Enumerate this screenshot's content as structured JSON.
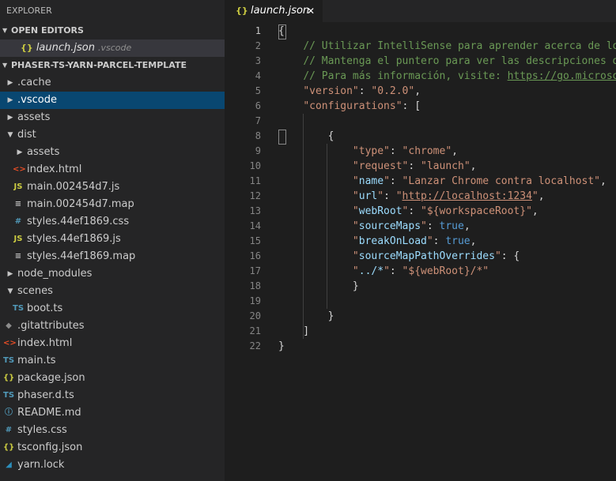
{
  "explorer": {
    "title": "EXPLORER"
  },
  "open_editors": {
    "header": "OPEN EDITORS",
    "items": [
      {
        "icon": "{}",
        "name": "launch.json",
        "dir": ".vscode"
      }
    ]
  },
  "project": {
    "header": "PHASER-TS-YARN-PARCEL-TEMPLATE",
    "tree": [
      {
        "name": ".cache",
        "kind": "folder",
        "expanded": false,
        "depth": 0
      },
      {
        "name": ".vscode",
        "kind": "folder",
        "expanded": false,
        "depth": 0,
        "active": true
      },
      {
        "name": "assets",
        "kind": "folder",
        "expanded": false,
        "depth": 0
      },
      {
        "name": "dist",
        "kind": "folder",
        "expanded": true,
        "depth": 0
      },
      {
        "name": "assets",
        "kind": "folder",
        "expanded": false,
        "depth": 1
      },
      {
        "name": "index.html",
        "kind": "html",
        "icon": "<>",
        "depth": 1
      },
      {
        "name": "main.002454d7.js",
        "kind": "js",
        "icon": "JS",
        "depth": 1
      },
      {
        "name": "main.002454d7.map",
        "kind": "map",
        "icon": "≡",
        "depth": 1
      },
      {
        "name": "styles.44ef1869.css",
        "kind": "css",
        "icon": "#",
        "depth": 1
      },
      {
        "name": "styles.44ef1869.js",
        "kind": "js",
        "icon": "JS",
        "depth": 1
      },
      {
        "name": "styles.44ef1869.map",
        "kind": "map",
        "icon": "≡",
        "depth": 1
      },
      {
        "name": "node_modules",
        "kind": "folder",
        "expanded": false,
        "depth": 0
      },
      {
        "name": "scenes",
        "kind": "folder",
        "expanded": true,
        "depth": 0
      },
      {
        "name": "boot.ts",
        "kind": "ts",
        "icon": "TS",
        "depth": 1
      },
      {
        "name": ".gitattributes",
        "kind": "git",
        "icon": "◆",
        "depth": 0
      },
      {
        "name": "index.html",
        "kind": "html",
        "icon": "<>",
        "depth": 0
      },
      {
        "name": "main.ts",
        "kind": "ts",
        "icon": "TS",
        "depth": 0
      },
      {
        "name": "package.json",
        "kind": "json",
        "icon": "{}",
        "depth": 0
      },
      {
        "name": "phaser.d.ts",
        "kind": "ts",
        "icon": "TS",
        "depth": 0
      },
      {
        "name": "README.md",
        "kind": "info",
        "icon": "ⓘ",
        "depth": 0
      },
      {
        "name": "styles.css",
        "kind": "css",
        "icon": "#",
        "depth": 0
      },
      {
        "name": "tsconfig.json",
        "kind": "json",
        "icon": "{}",
        "depth": 0
      },
      {
        "name": "yarn.lock",
        "kind": "yarn",
        "icon": "◢",
        "depth": 0
      }
    ]
  },
  "tab": {
    "icon": "{}",
    "label": "launch.json",
    "close": "✕"
  },
  "editor": {
    "current_line": 1,
    "lines": [
      [
        [
          "p",
          "{"
        ]
      ],
      [
        [
          "p",
          "    "
        ],
        [
          "cm",
          "// Utilizar IntelliSense para aprender acerca de los"
        ]
      ],
      [
        [
          "p",
          "    "
        ],
        [
          "cm",
          "// Mantenga el puntero para ver las descripciones de"
        ]
      ],
      [
        [
          "p",
          "    "
        ],
        [
          "cm",
          "// Para más información, visite: "
        ],
        [
          "link",
          "https://go.microsoft"
        ]
      ],
      [
        [
          "p",
          "    "
        ],
        [
          "str",
          "\"version\""
        ],
        [
          "p",
          ": "
        ],
        [
          "str",
          "\"0.2.0\""
        ],
        [
          "p",
          ","
        ]
      ],
      [
        [
          "p",
          "    "
        ],
        [
          "str",
          "\"configurations\""
        ],
        [
          "p",
          ": ["
        ]
      ],
      [],
      [
        [
          "p",
          "        {"
        ]
      ],
      [
        [
          "p",
          "            "
        ],
        [
          "str",
          "\"type\""
        ],
        [
          "p",
          ": "
        ],
        [
          "str",
          "\"chrome\""
        ],
        [
          "p",
          ","
        ]
      ],
      [
        [
          "p",
          "            "
        ],
        [
          "str",
          "\"request\""
        ],
        [
          "p",
          ": "
        ],
        [
          "str",
          "\"launch\""
        ],
        [
          "p",
          ","
        ]
      ],
      [
        [
          "p",
          "            "
        ],
        [
          "keyq",
          "\""
        ],
        [
          "key",
          "name"
        ],
        [
          "keyq",
          "\""
        ],
        [
          "p",
          ": "
        ],
        [
          "str",
          "\"Lanzar Chrome contra localhost\""
        ],
        [
          "p",
          ","
        ]
      ],
      [
        [
          "p",
          "            "
        ],
        [
          "keyq",
          "\""
        ],
        [
          "key",
          "url"
        ],
        [
          "keyq",
          "\""
        ],
        [
          "p",
          ": "
        ],
        [
          "str",
          "\""
        ],
        [
          "url",
          "http://localhost:1234"
        ],
        [
          "str",
          "\""
        ],
        [
          "p",
          ","
        ]
      ],
      [
        [
          "p",
          "            "
        ],
        [
          "keyq",
          "\""
        ],
        [
          "key",
          "webRoot"
        ],
        [
          "keyq",
          "\""
        ],
        [
          "p",
          ": "
        ],
        [
          "str",
          "\"${workspaceRoot}\""
        ],
        [
          "p",
          ","
        ]
      ],
      [
        [
          "p",
          "            "
        ],
        [
          "keyq",
          "\""
        ],
        [
          "key",
          "sourceMaps"
        ],
        [
          "keyq",
          "\""
        ],
        [
          "p",
          ": "
        ],
        [
          "bool",
          "true"
        ],
        [
          "p",
          ","
        ]
      ],
      [
        [
          "p",
          "            "
        ],
        [
          "keyq",
          "\""
        ],
        [
          "key",
          "breakOnLoad"
        ],
        [
          "keyq",
          "\""
        ],
        [
          "p",
          ": "
        ],
        [
          "bool",
          "true"
        ],
        [
          "p",
          ","
        ]
      ],
      [
        [
          "p",
          "            "
        ],
        [
          "keyq",
          "\""
        ],
        [
          "key",
          "sourceMapPathOverrides"
        ],
        [
          "keyq",
          "\""
        ],
        [
          "p",
          ": {"
        ]
      ],
      [
        [
          "p",
          "            "
        ],
        [
          "keyq",
          "\""
        ],
        [
          "key",
          "../*"
        ],
        [
          "keyq",
          "\""
        ],
        [
          "p",
          ": "
        ],
        [
          "str",
          "\"${webRoot}/*\""
        ]
      ],
      [
        [
          "p",
          "            }"
        ]
      ],
      [],
      [
        [
          "p",
          "        }"
        ]
      ],
      [
        [
          "p",
          "    ]"
        ]
      ],
      [
        [
          "p",
          "}"
        ]
      ]
    ]
  }
}
